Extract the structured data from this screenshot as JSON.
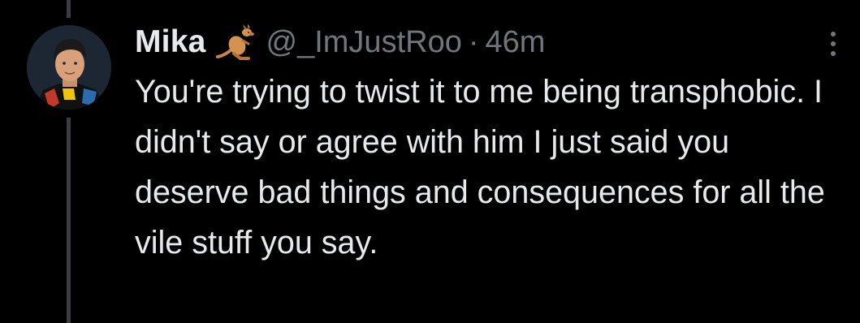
{
  "tweet": {
    "author_name": "Mika",
    "author_emoji": "kangaroo-emoji",
    "handle": "@_ImJustRoo",
    "separator": "·",
    "timestamp": "46m",
    "text": "You're trying to twist it to me being transphobic. I didn't say or agree with him I just said you deserve bad things and consequences for all the vile stuff you say."
  },
  "icons": {
    "more": "more-vertical-icon"
  },
  "colors": {
    "background": "#000000",
    "primary_text": "#e7e9ea",
    "secondary_text": "#71767b",
    "thread_line": "#3a3e42"
  }
}
